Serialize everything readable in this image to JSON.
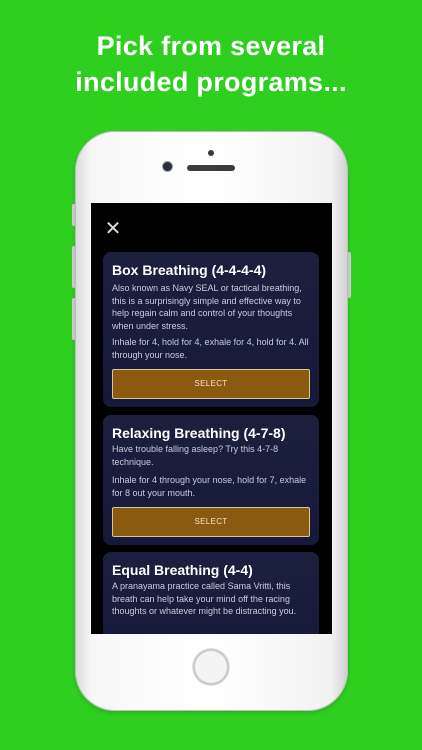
{
  "headline": {
    "line1": "Pick from several",
    "line2": "included programs..."
  },
  "screen": {
    "close_icon": "close-icon",
    "programs": [
      {
        "title": "Box Breathing (4-4-4-4)",
        "description": "Also known as Navy SEAL or tactical breathing, this is a surprisingly simple and effective way to help regain calm and control of your thoughts when under stress.",
        "instructions": "Inhale for 4, hold for 4, exhale for 4, hold for 4. All through your nose.",
        "button_label": "SELECT"
      },
      {
        "title": "Relaxing Breathing (4-7-8)",
        "description": "Have trouble falling asleep? Try this 4-7-8 technique.",
        "instructions": "Inhale for 4 through your nose, hold for 7, exhale for 8 out your mouth.",
        "button_label": "SELECT"
      },
      {
        "title": "Equal Breathing (4-4)",
        "description": "A pranayama practice called Sama Vritti, this breath can help take your mind off the racing thoughts or whatever might be distracting you.",
        "instructions": "",
        "button_label": ""
      }
    ]
  },
  "colors": {
    "background": "#2ecf1f",
    "card": "#1c1f3e",
    "button": "#8a5a10"
  }
}
